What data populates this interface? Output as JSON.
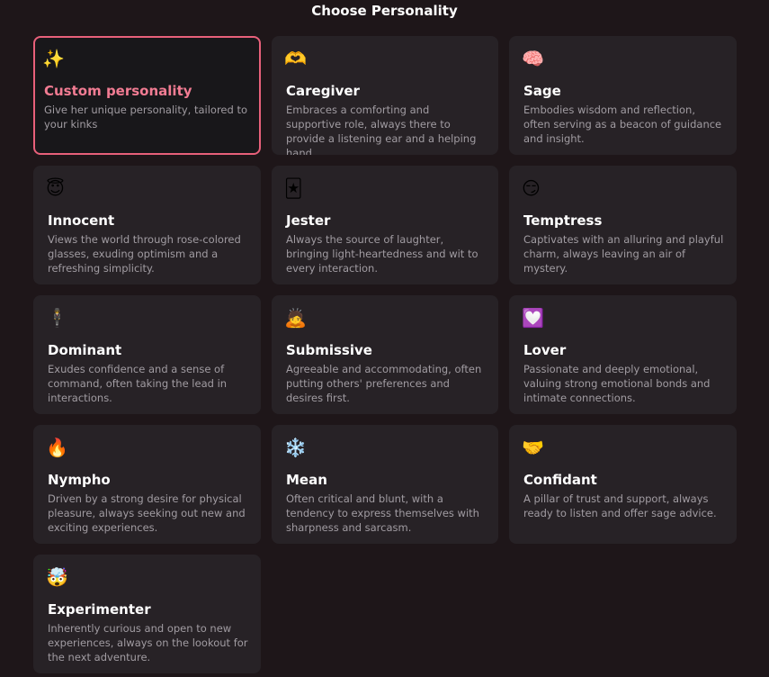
{
  "header": {
    "title": "Choose Personality"
  },
  "cards": [
    {
      "icon": "✨",
      "icon_name": "sparkles-icon",
      "name": "Custom personality",
      "desc": "Give her unique personality, tailored to your kinks"
    },
    {
      "icon": "🫶",
      "icon_name": "heart-hands-icon",
      "name": "Caregiver",
      "desc": "Embraces a comforting and supportive role, always there to provide a listening ear and a helping hand."
    },
    {
      "icon": "🧠",
      "icon_name": "brain-icon",
      "name": "Sage",
      "desc": "Embodies wisdom and reflection, often serving as a beacon of guidance and insight."
    },
    {
      "icon": "😇",
      "icon_name": "angel-icon",
      "name": "Innocent",
      "desc": "Views the world through rose-colored glasses, exuding optimism and a refreshing simplicity."
    },
    {
      "icon": "🃏",
      "icon_name": "jester-icon",
      "name": "Jester",
      "desc": "Always the source of laughter, bringing light-heartedness and wit to every interaction."
    },
    {
      "icon": "😏",
      "icon_name": "smirk-icon",
      "name": "Temptress",
      "desc": "Captivates with an alluring and playful charm, always leaving an air of mystery."
    },
    {
      "icon": "🕴",
      "icon_name": "dominant-figure-icon",
      "name": "Dominant",
      "desc": "Exudes confidence and a sense of command, often taking the lead in interactions."
    },
    {
      "icon": "🙇",
      "icon_name": "bowing-icon",
      "name": "Submissive",
      "desc": "Agreeable and accommodating, often putting others' preferences and desires first."
    },
    {
      "icon": "💟",
      "icon_name": "heart-bubble-icon",
      "name": "Lover",
      "desc": "Passionate and deeply emotional, valuing strong emotional bonds and intimate connections."
    },
    {
      "icon": "🔥",
      "icon_name": "fire-icon",
      "name": "Nympho",
      "desc": "Driven by a strong desire for physical pleasure, always seeking out new and exciting experiences."
    },
    {
      "icon": "❄️",
      "icon_name": "snowflake-icon",
      "name": "Mean",
      "desc": "Often critical and blunt, with a tendency to express themselves with sharpness and sarcasm."
    },
    {
      "icon": "🤝",
      "icon_name": "handshake-icon",
      "name": "Confidant",
      "desc": "A pillar of trust and support, always ready to listen and offer sage advice."
    },
    {
      "icon": "🤯",
      "icon_name": "mind-blown-icon",
      "name": "Experimenter",
      "desc": "Inherently curious and open to new experiences, always on the lookout for the next adventure."
    }
  ],
  "colors": {
    "background": "#1e1619",
    "card": "#272226",
    "selected_border": "#e8607a",
    "selected_title": "#f27c93"
  }
}
